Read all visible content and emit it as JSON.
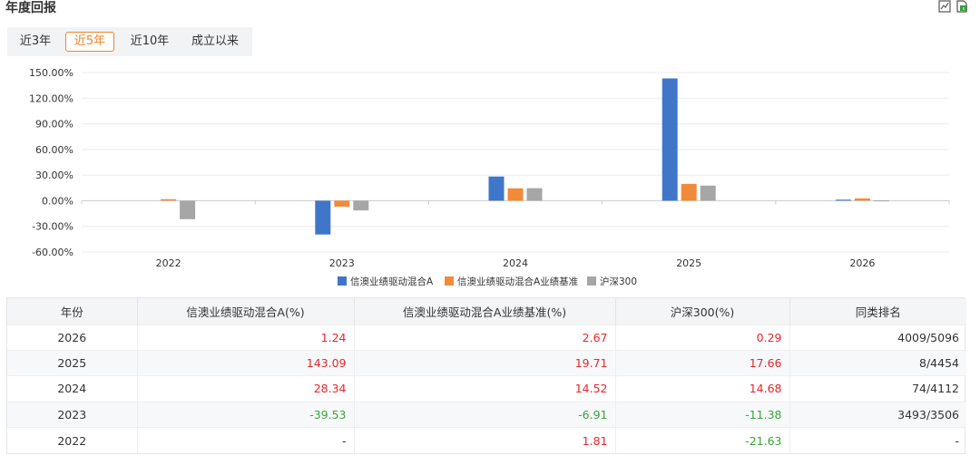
{
  "page": {
    "title": "年度回报"
  },
  "header_icons": [
    "chart-toggle-icon",
    "export-excel-icon"
  ],
  "tabs": [
    {
      "label": "近3年",
      "active": false
    },
    {
      "label": "近5年",
      "active": true
    },
    {
      "label": "近10年",
      "active": false
    },
    {
      "label": "成立以来",
      "active": false
    }
  ],
  "colors": {
    "series_a": "#3f76c9",
    "benchmark": "#f28a3b",
    "hs300": "#a6a6a6",
    "positive": "#e8262c",
    "negative": "#3ba33b",
    "active_tab": "#f0832a"
  },
  "chart_data": {
    "type": "bar",
    "categories": [
      "2022",
      "2023",
      "2024",
      "2025",
      "2026"
    ],
    "series": [
      {
        "name": "信澳业绩驱动混合A",
        "values": [
          null,
          -39.53,
          28.34,
          143.09,
          1.24
        ]
      },
      {
        "name": "信澳业绩驱动混合A业绩基准",
        "values": [
          1.81,
          -6.91,
          14.52,
          19.71,
          2.67
        ]
      },
      {
        "name": "沪深300",
        "values": [
          -21.63,
          -11.38,
          14.68,
          17.66,
          0.29
        ]
      }
    ],
    "yticks": [
      "150.00%",
      "120.00%",
      "90.00%",
      "60.00%",
      "30.00%",
      "0.00%",
      "-30.00%",
      "-60.00%"
    ],
    "ylim": [
      -60,
      150
    ],
    "grid": true,
    "legend": "bottom"
  },
  "table": {
    "headers": [
      "年份",
      "信澳业绩驱动混合A(%)",
      "信澳业绩驱动混合A业绩基准(%)",
      "沪深300(%)",
      "同类排名"
    ],
    "rows": [
      [
        "2026",
        "1.24",
        "2.67",
        "0.29",
        "4009/5096"
      ],
      [
        "2025",
        "143.09",
        "19.71",
        "17.66",
        "8/4454"
      ],
      [
        "2024",
        "28.34",
        "14.52",
        "14.68",
        "74/4112"
      ],
      [
        "2023",
        "-39.53",
        "-6.91",
        "-11.38",
        "3493/3506"
      ],
      [
        "2022",
        "-",
        "1.81",
        "-21.63",
        "-"
      ]
    ]
  }
}
